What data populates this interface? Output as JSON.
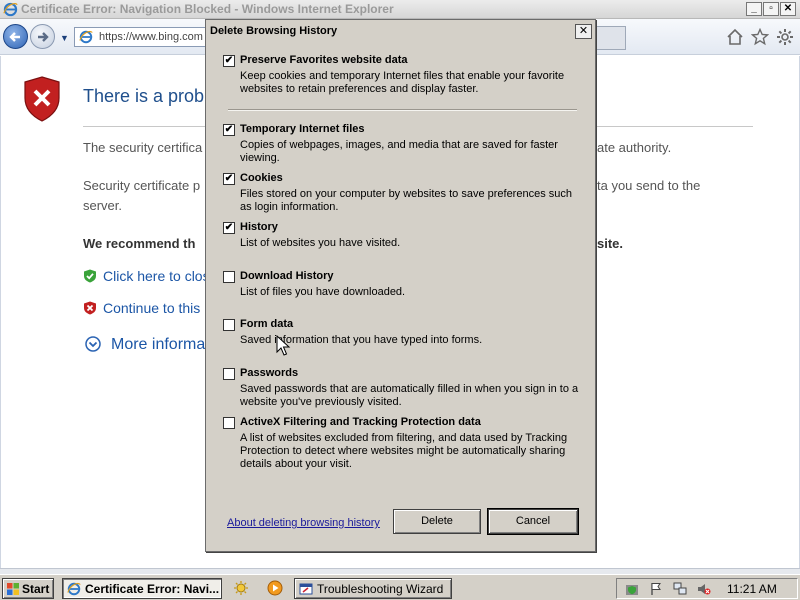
{
  "window": {
    "title": "Certificate Error: Navigation Blocked - Windows Internet Explorer",
    "address": "https://www.bing.com"
  },
  "page": {
    "heading": "There is a probl",
    "line1_left": "The security certifica",
    "line1_right": "ate authority.",
    "line2_left": "Security certificate p",
    "line2_right": "ta you send to the",
    "line2_cont": "server.",
    "recommend_left": "We recommend th",
    "recommend_right": "site.",
    "link_close": "Click here to clos",
    "link_continue": "Continue to this",
    "link_more": "More informa"
  },
  "dialog": {
    "title": "Delete Browsing History",
    "close_label": "✕",
    "options": [
      {
        "title": "Preserve Favorites website data",
        "desc": "Keep cookies and temporary Internet files that enable your favorite websites to retain preferences and display faster.",
        "checked": true
      },
      {
        "title": "Temporary Internet files",
        "desc": "Copies of webpages, images, and media that are saved for faster viewing.",
        "checked": true
      },
      {
        "title": "Cookies",
        "desc": "Files stored on your computer by websites to save preferences such as login information.",
        "checked": true
      },
      {
        "title": "History",
        "desc": "List of websites you have visited.",
        "checked": true
      },
      {
        "title": "Download History",
        "desc": "List of files you have downloaded.",
        "checked": false
      },
      {
        "title": "Form data",
        "desc": "Saved information that you have typed into forms.",
        "checked": false
      },
      {
        "title": "Passwords",
        "desc": "Saved passwords that are automatically filled in when you sign in to a website you've previously visited.",
        "checked": false
      },
      {
        "title": "ActiveX Filtering and Tracking Protection data",
        "desc": "A list of websites excluded from filtering, and data used by Tracking Protection to detect where websites might be automatically sharing details about your visit.",
        "checked": false
      }
    ],
    "about_link": "About deleting browsing history",
    "delete_label": "Delete",
    "cancel_label": "Cancel"
  },
  "taskbar": {
    "start_label": "Start",
    "task_ie": "Certificate Error: Navi...",
    "task_wizard": "Troubleshooting Wizard",
    "clock": "11:21 AM"
  },
  "icons": {
    "ie_logo": "internet-explorer-icon",
    "cert_error": "shield-error-icon",
    "home": "home-icon",
    "favorites": "star-icon",
    "tools": "gear-icon"
  },
  "colors": {
    "dialog_bg": "#d4d0c8",
    "link": "#1c56a6",
    "heading": "#1f4f8c"
  }
}
